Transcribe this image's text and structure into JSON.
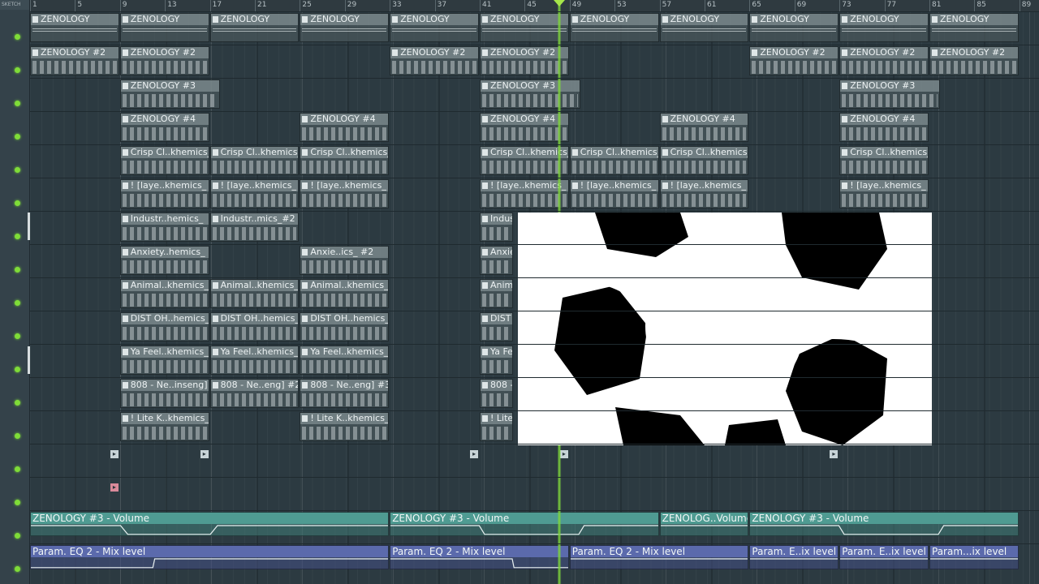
{
  "sidebar": {
    "label": "SKETCH"
  },
  "ruler": {
    "ticks": [
      "1",
      "5",
      "9",
      "13",
      "17",
      "21",
      "25",
      "29",
      "33",
      "37",
      "41",
      "45",
      "49",
      "53",
      "57",
      "61",
      "65",
      "69",
      "73",
      "77",
      "81",
      "85",
      "89"
    ]
  },
  "clips": [
    {
      "label": "ZENOLOGY",
      "lane": 0,
      "bars": [
        1,
        9,
        17,
        25,
        33,
        41,
        49,
        57,
        65,
        73,
        81
      ],
      "len": 8,
      "dense": true
    },
    {
      "label": "ZENOLOGY #2",
      "lane": 1,
      "bars": [
        1,
        9,
        33,
        41,
        65,
        73,
        81
      ],
      "len": 8
    },
    {
      "label": "ZENOLOGY #3",
      "lane": 2,
      "bars": [
        9,
        41,
        73
      ],
      "len": 9
    },
    {
      "label": "ZENOLOGY #4",
      "lane": 3,
      "bars": [
        9,
        25,
        41,
        57,
        73
      ],
      "len": 8
    },
    {
      "label": "Crisp Cl..khemics_",
      "lane": 4,
      "bars": [
        9,
        17,
        25,
        41,
        49,
        57,
        73
      ],
      "len": 8
    },
    {
      "label": "! [laye..khemics_",
      "lane": 5,
      "bars": [
        9,
        17,
        25,
        41,
        49,
        57,
        73
      ],
      "len": 8
    },
    {
      "label": "Industr..hemics_",
      "lane": 6,
      "bars": [
        9
      ],
      "len": 8
    },
    {
      "label": "Industr..mics_#2",
      "lane": 6,
      "bars": [
        17
      ],
      "len": 8
    },
    {
      "label": "Indus",
      "lane": 6,
      "bars": [
        41
      ],
      "len": 3
    },
    {
      "label": "Anxiety..hemics_",
      "lane": 7,
      "bars": [
        9
      ],
      "len": 8
    },
    {
      "label": "Anxie..ics_ #2",
      "lane": 7,
      "bars": [
        25
      ],
      "len": 8
    },
    {
      "label": "Anxie",
      "lane": 7,
      "bars": [
        41
      ],
      "len": 3
    },
    {
      "label": "Animal..khemics_",
      "lane": 8,
      "bars": [
        9,
        17,
        25
      ],
      "len": 8
    },
    {
      "label": "Anima",
      "lane": 8,
      "bars": [
        41
      ],
      "len": 3
    },
    {
      "label": "DIST OH..hemics_",
      "lane": 9,
      "bars": [
        9,
        17,
        25
      ],
      "len": 8
    },
    {
      "label": "DIST O",
      "lane": 9,
      "bars": [
        41
      ],
      "len": 3
    },
    {
      "label": "Ya Feel..khemics_",
      "lane": 10,
      "bars": [
        9,
        17,
        25
      ],
      "len": 8
    },
    {
      "label": "Ya Fe",
      "lane": 10,
      "bars": [
        41
      ],
      "len": 3
    },
    {
      "label": "808 - Ne..inseng]",
      "lane": 11,
      "bars": [
        9
      ],
      "len": 8
    },
    {
      "label": "808 - Ne..eng] #2",
      "lane": 11,
      "bars": [
        17
      ],
      "len": 8
    },
    {
      "label": "808 - Ne..eng] #3",
      "lane": 11,
      "bars": [
        25
      ],
      "len": 8
    },
    {
      "label": "808 -",
      "lane": 11,
      "bars": [
        41
      ],
      "len": 3
    },
    {
      "label": "! Lite K..khemics_",
      "lane": 12,
      "bars": [
        9,
        25
      ],
      "len": 8
    },
    {
      "label": "! Lite",
      "lane": 12,
      "bars": [
        41
      ],
      "len": 3
    }
  ],
  "markers": [
    {
      "lane": 13,
      "bars": [
        8,
        16,
        40,
        48,
        72
      ]
    },
    {
      "lane": 14,
      "bars": [
        8
      ]
    }
  ],
  "automation": [
    {
      "label": "ZENOLOGY #3 - Volume",
      "color": "teal",
      "start": 1,
      "len": 32,
      "pts": [
        [
          0,
          1
        ],
        [
          0.25,
          1
        ],
        [
          0.27,
          0.1
        ],
        [
          0.5,
          0.1
        ],
        [
          0.52,
          1
        ],
        [
          1,
          1
        ]
      ]
    },
    {
      "label": "ZENOLOGY #3 - Volume",
      "color": "teal",
      "start": 33,
      "len": 24,
      "pts": [
        [
          0,
          1
        ],
        [
          0.33,
          1
        ],
        [
          0.35,
          0.1
        ],
        [
          0.7,
          0.1
        ],
        [
          0.72,
          1
        ],
        [
          1,
          1
        ]
      ]
    },
    {
      "label": "ZENOLOG..Volume",
      "color": "teal",
      "start": 57,
      "len": 8,
      "pts": [
        [
          0,
          1
        ],
        [
          1,
          1
        ]
      ]
    },
    {
      "label": "ZENOLOGY #3 - Volume",
      "color": "teal",
      "start": 65,
      "len": 24,
      "pts": [
        [
          0,
          1
        ],
        [
          0.33,
          1
        ],
        [
          0.35,
          0.1
        ],
        [
          0.7,
          0.1
        ],
        [
          0.72,
          1
        ],
        [
          1,
          1
        ]
      ]
    },
    {
      "label": "Param. EQ 2 - Mix level",
      "color": "purple",
      "start": 1,
      "len": 32,
      "pts": [
        [
          0,
          0.1
        ],
        [
          0.34,
          0.1
        ],
        [
          0.345,
          1
        ],
        [
          1,
          1
        ]
      ]
    },
    {
      "label": "Param. EQ 2 - Mix level",
      "color": "purple",
      "start": 33,
      "len": 16,
      "pts": [
        [
          0,
          1
        ],
        [
          0.68,
          1
        ],
        [
          0.69,
          0.1
        ],
        [
          1,
          0.1
        ]
      ]
    },
    {
      "label": "Param. EQ 2 - Mix level",
      "color": "purple",
      "start": 49,
      "len": 16,
      "pts": [
        [
          0,
          1
        ],
        [
          1,
          1
        ]
      ]
    },
    {
      "label": "Param. E..ix level",
      "color": "purple",
      "start": 65,
      "len": 8,
      "pts": [
        [
          0,
          1
        ],
        [
          1,
          1
        ]
      ]
    },
    {
      "label": "Param. E..ix level",
      "color": "purple",
      "start": 73,
      "len": 8,
      "pts": [
        [
          0,
          1
        ],
        [
          1,
          1
        ]
      ]
    },
    {
      "label": "Param...ix level",
      "color": "purple",
      "start": 81,
      "len": 8,
      "pts": [
        [
          0,
          1
        ],
        [
          1,
          1
        ]
      ]
    }
  ]
}
